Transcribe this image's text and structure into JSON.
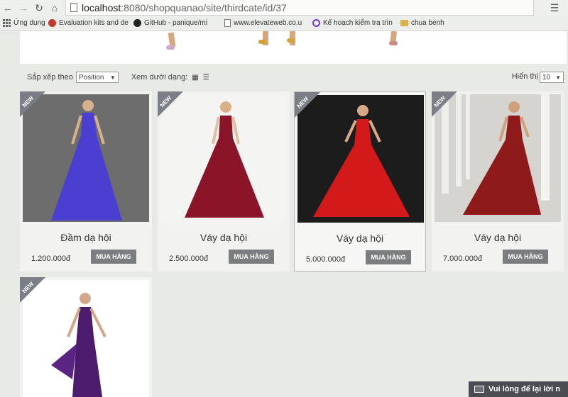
{
  "browser": {
    "url_host": "localhost",
    "url_path": ":8080/shopquanao/site/thirdcate/id/37",
    "bookmarks": [
      {
        "label": "Ứng dụng",
        "icon": "apps-icon"
      },
      {
        "label": "Evaluation kits and de",
        "icon": "red-circle-icon"
      },
      {
        "label": "GitHub - panique/mi",
        "icon": "github-icon"
      },
      {
        "label": "www.elevateweb.co.u",
        "icon": "document-icon"
      },
      {
        "label": "Kế hoạch kiểm tra trìn",
        "icon": "link-icon"
      },
      {
        "label": "chua benh",
        "icon": "folder-icon"
      }
    ]
  },
  "toolbar": {
    "sort_label": "Sắp xếp theo",
    "sort_value": "Position",
    "view_label": "Xem dưới dạng:",
    "show_label": "Hiển thị",
    "show_value": "10"
  },
  "products": [
    {
      "badge": "NEW",
      "name": "Đầm dạ hội",
      "price": "1.200.000đ",
      "buy_label": "MUA HÀNG",
      "dress_color": "#4a3fd0",
      "bg": "#7a7a7a"
    },
    {
      "badge": "NEW",
      "name": "Váy dạ hội",
      "price": "2.500.000đ",
      "buy_label": "MUA HÀNG",
      "dress_color": "#8a1428",
      "bg": "#f4f4f2"
    },
    {
      "badge": "NEW",
      "name": "Váy dạ hội",
      "price": "5.000.000đ",
      "buy_label": "MUA HÀNG",
      "dress_color": "#d21a1a",
      "bg": "#1a1a1a"
    },
    {
      "badge": "NEW",
      "name": "Váy dạ hội",
      "price": "7.000.000đ",
      "buy_label": "MUA HÀNG",
      "dress_color": "#8e1a1c",
      "bg": "#c9c7c2"
    },
    {
      "badge": "NEW",
      "dress_color": "#4b1b6e",
      "bg": "#ffffff"
    }
  ],
  "chat": {
    "label": "Vui lòng để lại lời n"
  }
}
